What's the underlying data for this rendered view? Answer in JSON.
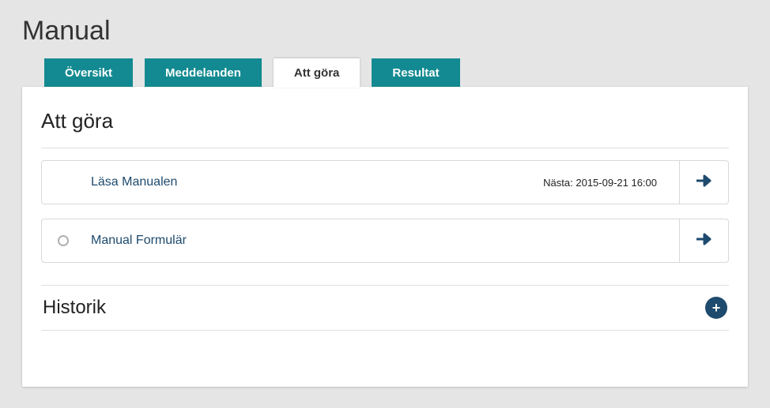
{
  "page_title": "Manual",
  "tabs": {
    "overview": "Översikt",
    "messages": "Meddelanden",
    "todo": "Att göra",
    "results": "Resultat"
  },
  "section": {
    "title": "Att göra"
  },
  "items": [
    {
      "title": "Läsa Manualen",
      "meta": "Nästa: 2015-09-21 16:00",
      "has_radio": false
    },
    {
      "title": "Manual Formulär",
      "meta": "",
      "has_radio": true
    }
  ],
  "history": {
    "title": "Historik"
  }
}
